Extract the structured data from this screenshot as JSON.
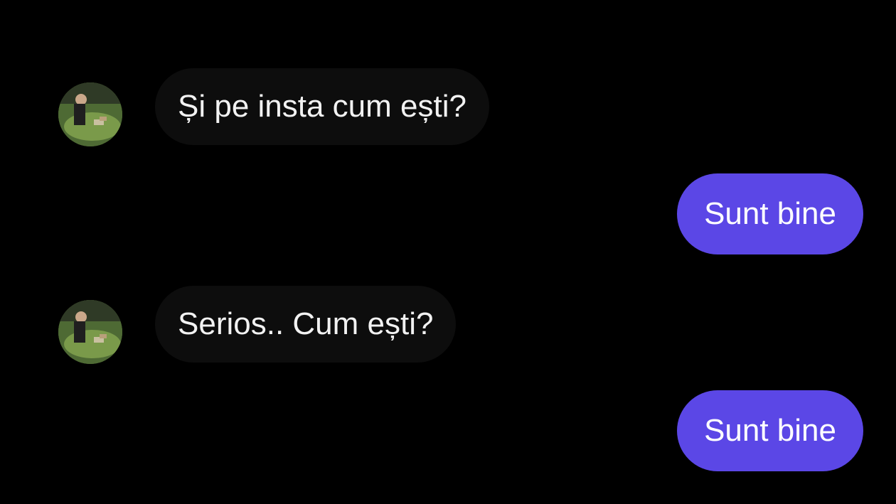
{
  "conversation": {
    "messages": [
      {
        "direction": "incoming",
        "text": "Și pe insta cum ești?"
      },
      {
        "direction": "outgoing",
        "text": "Sunt bine"
      },
      {
        "direction": "incoming",
        "text": "Serios.. Cum ești?"
      },
      {
        "direction": "outgoing",
        "text": "Sunt bine"
      }
    ],
    "contact_avatar_icon": "profile-photo-icon"
  },
  "colors": {
    "background": "#000000",
    "incoming_bubble": "#0d0d0d",
    "outgoing_bubble": "#5b47e6",
    "text": "#f2f2f2"
  }
}
